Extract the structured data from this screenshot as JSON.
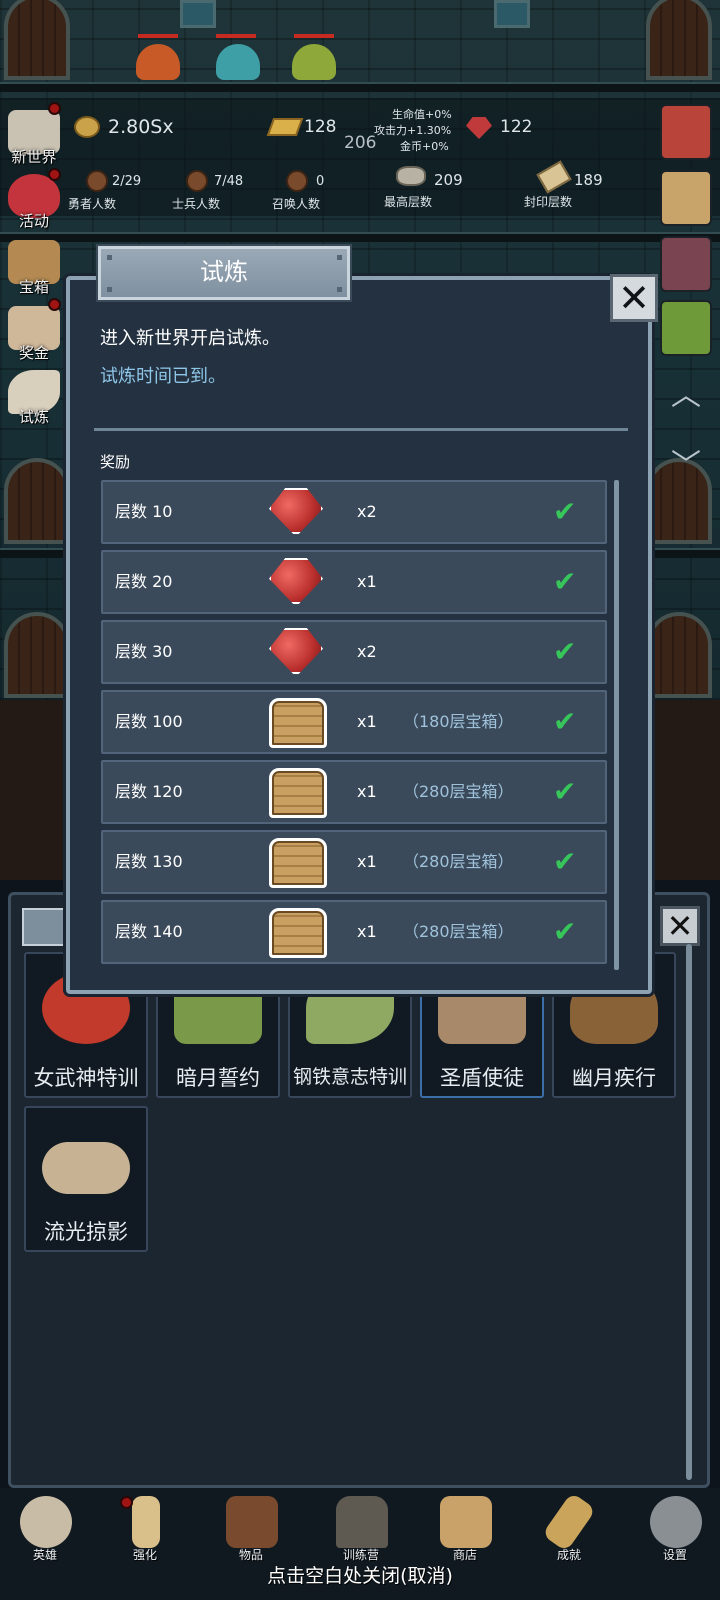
{
  "hud": {
    "gold": "2.80Sx",
    "ingot": "128",
    "gem": "122",
    "mid_value": "206",
    "bonus_hp": "生命值+0%",
    "bonus_atk": "攻击力+1.30%",
    "bonus_gold": "金币+0%",
    "heroes": {
      "value": "2/29",
      "label": "勇者人数"
    },
    "soldiers": {
      "value": "7/48",
      "label": "士兵人数"
    },
    "summons": {
      "value": "0",
      "label": "召唤人数"
    },
    "max_floor": {
      "value": "209",
      "label": "最高层数"
    },
    "sealed_floor": {
      "value": "189",
      "label": "封印层数"
    }
  },
  "side_menu": [
    {
      "label": "新世界"
    },
    {
      "label": "活动"
    },
    {
      "label": "宝箱"
    },
    {
      "label": "奖金"
    },
    {
      "label": "试炼"
    }
  ],
  "modal": {
    "title": "试炼",
    "description": "进入新世界开启试炼。",
    "status": "试炼时间已到。",
    "rewards_label": "奖励",
    "rows": [
      {
        "layer": "层数 10",
        "icon": "gem-icon",
        "qty": "x2",
        "note": "",
        "check": "✔"
      },
      {
        "layer": "层数 20",
        "icon": "gem-icon",
        "qty": "x1",
        "note": "",
        "check": "✔"
      },
      {
        "layer": "层数 30",
        "icon": "gem-icon",
        "qty": "x2",
        "note": "",
        "check": "✔"
      },
      {
        "layer": "层数 100",
        "icon": "chest-icon",
        "qty": "x1",
        "note": "（180层宝箱）",
        "check": "✔"
      },
      {
        "layer": "层数 120",
        "icon": "chest-icon",
        "qty": "x1",
        "note": "（280层宝箱）",
        "check": "✔"
      },
      {
        "layer": "层数 130",
        "icon": "chest-icon",
        "qty": "x1",
        "note": "（280层宝箱）",
        "check": "✔"
      },
      {
        "layer": "层数 140",
        "icon": "chest-icon",
        "qty": "x1",
        "note": "（280层宝箱）",
        "check": "✔"
      }
    ]
  },
  "skills": [
    {
      "name": "女武神特训"
    },
    {
      "name": "暗月誓约"
    },
    {
      "name": "钢铁意志特训"
    },
    {
      "name": "圣盾使徒"
    },
    {
      "name": "幽月疾行"
    },
    {
      "name": "流光掠影"
    }
  ],
  "bottom_nav": [
    {
      "label": "英雄"
    },
    {
      "label": "强化"
    },
    {
      "label": "物品"
    },
    {
      "label": "训练营"
    },
    {
      "label": "商店"
    },
    {
      "label": "成就"
    },
    {
      "label": "设置"
    }
  ],
  "close_hint": "点击空白处关闭(取消)",
  "colors": {
    "panel": "#243140",
    "row": "#3b4a5b",
    "check": "#36c65a",
    "status_text": "#8ec6e8"
  }
}
